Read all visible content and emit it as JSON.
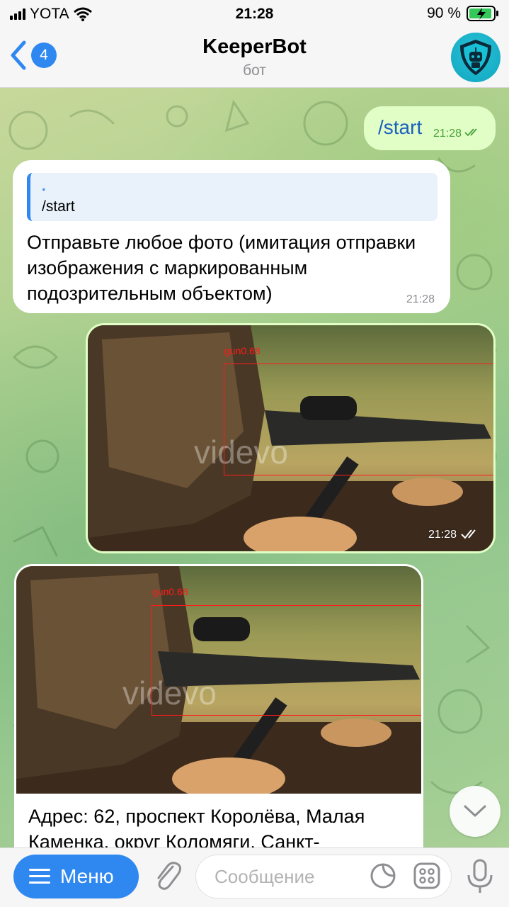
{
  "status_bar": {
    "carrier": "YOTA",
    "time": "21:28",
    "battery": "90 %"
  },
  "header": {
    "back_count": "4",
    "title": "KeeperBot",
    "subtitle": "бот"
  },
  "messages": [
    {
      "type": "outgoing_text",
      "text": "/start",
      "time": "21:28"
    },
    {
      "type": "incoming_text",
      "reply_to_author": ".",
      "reply_to_text": "/start",
      "text": "Отправьте любое фото (имитация отправки изображения с маркированным подозрительным объектом)",
      "time": "21:28"
    },
    {
      "type": "outgoing_photo",
      "detection_label": "gun0.68",
      "watermark": "videvo",
      "time": "21:28"
    },
    {
      "type": "incoming_photo",
      "detection_label": "gun0.68",
      "watermark": "videvo",
      "caption": "Адрес: 62, проспект Королёва, Малая Каменка, округ Коломяги, Санкт-"
    }
  ],
  "input": {
    "menu_label": "Меню",
    "placeholder": "Сообщение"
  },
  "colors": {
    "accent": "#2f88f0",
    "outgoing_bubble": "#e1fec6",
    "incoming_bubble": "#ffffff",
    "detection_box": "#ff1a1a"
  }
}
